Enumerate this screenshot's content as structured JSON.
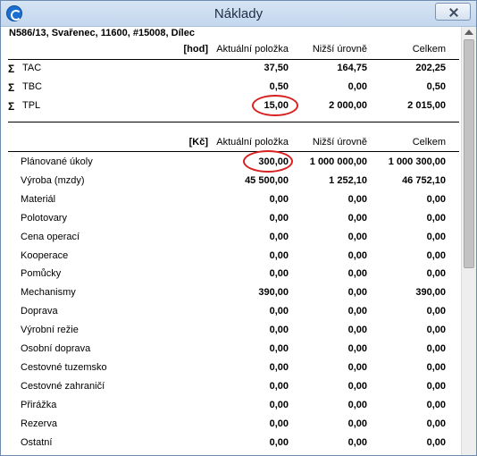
{
  "window": {
    "title": "Náklady"
  },
  "item": {
    "title": "N586/13, Svařenec, 11600, #15008, Dílec"
  },
  "hours_table": {
    "unit": "[hod]",
    "headers": {
      "current": "Aktuální položka",
      "lower": "Nižší úrovně",
      "total": "Celkem"
    },
    "rows": [
      {
        "sigma": "Σ",
        "label": "TAC",
        "current": "37,50",
        "lower": "164,75",
        "total": "202,25"
      },
      {
        "sigma": "Σ",
        "label": "TBC",
        "current": "0,50",
        "lower": "0,00",
        "total": "0,50"
      },
      {
        "sigma": "Σ",
        "label": "TPL",
        "current": "15,00",
        "lower": "2 000,00",
        "total": "2 015,00"
      }
    ]
  },
  "cost_table": {
    "unit": "[Kč]",
    "headers": {
      "current": "Aktuální položka",
      "lower": "Nižší úrovně",
      "total": "Celkem"
    },
    "rows": [
      {
        "label": "Plánované úkoly",
        "current": "300,00",
        "lower": "1 000 000,00",
        "total": "1 000 300,00"
      },
      {
        "label": "Výroba (mzdy)",
        "current": "45 500,00",
        "lower": "1 252,10",
        "total": "46 752,10"
      },
      {
        "label": "Materiál",
        "current": "0,00",
        "lower": "0,00",
        "total": "0,00"
      },
      {
        "label": "Polotovary",
        "current": "0,00",
        "lower": "0,00",
        "total": "0,00"
      },
      {
        "label": "Cena operací",
        "current": "0,00",
        "lower": "0,00",
        "total": "0,00"
      },
      {
        "label": "Kooperace",
        "current": "0,00",
        "lower": "0,00",
        "total": "0,00"
      },
      {
        "label": "Pomůcky",
        "current": "0,00",
        "lower": "0,00",
        "total": "0,00"
      },
      {
        "label": "Mechanismy",
        "current": "390,00",
        "lower": "0,00",
        "total": "390,00"
      },
      {
        "label": "Doprava",
        "current": "0,00",
        "lower": "0,00",
        "total": "0,00"
      },
      {
        "label": "Výrobní režie",
        "current": "0,00",
        "lower": "0,00",
        "total": "0,00"
      },
      {
        "label": "Osobní doprava",
        "current": "0,00",
        "lower": "0,00",
        "total": "0,00"
      },
      {
        "label": "Cestovné tuzemsko",
        "current": "0,00",
        "lower": "0,00",
        "total": "0,00"
      },
      {
        "label": "Cestovné zahraničí",
        "current": "0,00",
        "lower": "0,00",
        "total": "0,00"
      },
      {
        "label": "Přirážka",
        "current": "0,00",
        "lower": "0,00",
        "total": "0,00"
      },
      {
        "label": "Rezerva",
        "current": "0,00",
        "lower": "0,00",
        "total": "0,00"
      },
      {
        "label": "Ostatní",
        "current": "0,00",
        "lower": "0,00",
        "total": "0,00"
      }
    ]
  },
  "colors": {
    "highlight_ring": "#d82020",
    "titlebar": "#c3d7ee"
  }
}
